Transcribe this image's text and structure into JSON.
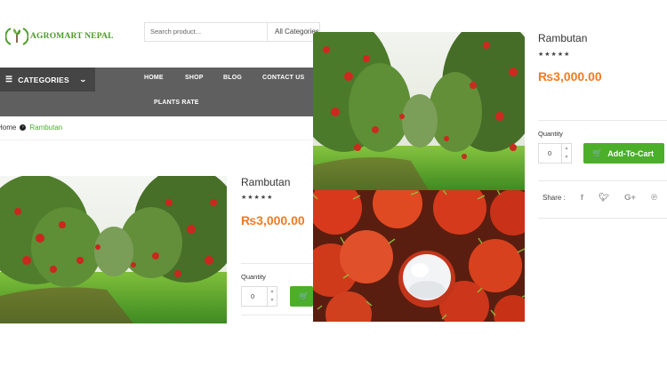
{
  "brand": {
    "name": "AGROMART NEPAL",
    "accent": "#4caf2a",
    "price_color": "#f47a20"
  },
  "search": {
    "placeholder": "Search product...",
    "category": "All Categories"
  },
  "nav": {
    "categories_label": "CATEGORIES",
    "items": [
      "HOME",
      "SHOP",
      "BLOG",
      "CONTACT US"
    ],
    "plants_rate": "PLANTS RATE"
  },
  "breadcrumb": {
    "home": "Home",
    "current": "Rambutan"
  },
  "product": {
    "title": "Rambutan",
    "rating": "★★★★★",
    "price": "₨3,000.00",
    "quantity_label": "Quantity",
    "quantity_value": "0",
    "add_to_cart": "Add-To-Cart",
    "share_label": "Share :"
  },
  "share_icons": [
    "facebook-icon",
    "twitter-icon",
    "google-plus-icon",
    "pinterest-icon"
  ]
}
